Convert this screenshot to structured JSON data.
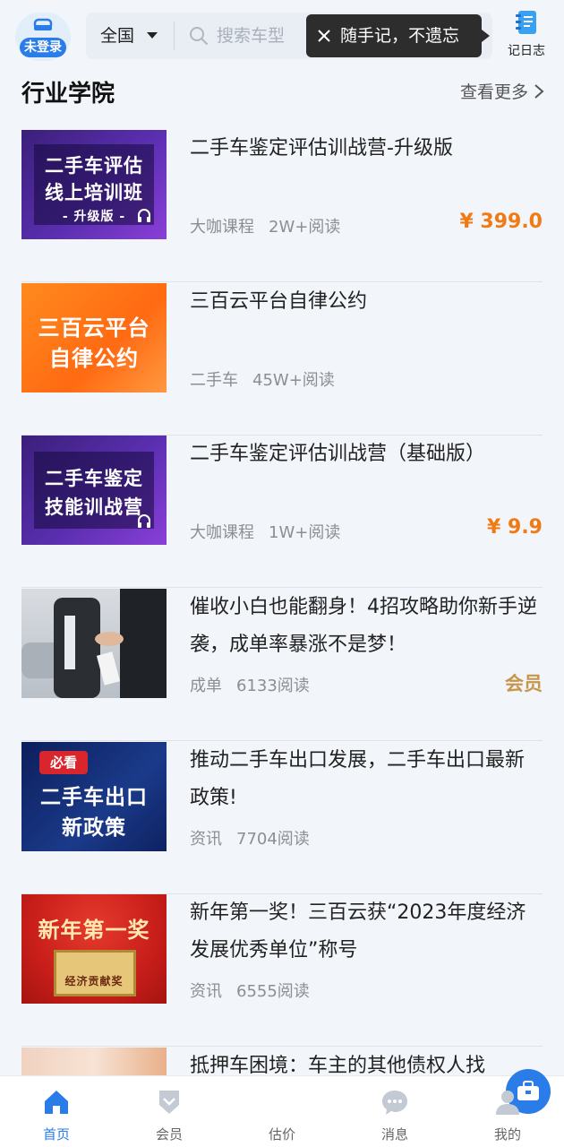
{
  "header": {
    "login_label": "未登录",
    "city": "全国",
    "search_placeholder": "搜索车型",
    "tooltip": "随手记，不遗忘",
    "diary_label": "记日志"
  },
  "section": {
    "title": "行业学院",
    "more_label": "查看更多"
  },
  "articles": [
    {
      "title": "二手车鉴定评估训战营-升级版",
      "category": "大咖课程",
      "reads": "2W+阅读",
      "price": "¥ 399.0",
      "thumb_lines": [
        "二手车评估",
        "线上培训班",
        "- 升级版 -"
      ]
    },
    {
      "title": "三百云平台自律公约",
      "category": "二手车",
      "reads": "45W+阅读",
      "thumb_lines": [
        "三百云平台",
        "自律公约"
      ]
    },
    {
      "title": "二手车鉴定评估训战营（基础版）",
      "category": "大咖课程",
      "reads": "1W+阅读",
      "price": "¥ 9.9",
      "thumb_lines": [
        "二手车鉴定",
        "技能训战营"
      ]
    },
    {
      "title": "催收小白也能翻身！4招攻略助你新手逆袭，成单率暴涨不是梦！",
      "category": "成单",
      "reads": "6133阅读",
      "badge": "会员"
    },
    {
      "title": "推动二手车出口发展，二手车出口最新政策!",
      "category": "资讯",
      "reads": "7704阅读",
      "thumb_tag": "必看",
      "thumb_lines": [
        "二手车出口",
        "新政策"
      ]
    },
    {
      "title": "新年第一奖！三百云获“2023年度经济发展优秀单位”称号",
      "category": "资讯",
      "reads": "6555阅读",
      "thumb_lines": [
        "新年第一奖",
        "经济贡献奖"
      ]
    },
    {
      "title": "抵押车困境：车主的其他债权人找"
    }
  ],
  "bottom_nav": [
    {
      "label": "首页",
      "active": true
    },
    {
      "label": "会员"
    },
    {
      "label": "估价"
    },
    {
      "label": "消息"
    },
    {
      "label": "我的"
    }
  ],
  "colors": {
    "accent": "#2a7ce8",
    "price": "#f07a13",
    "member": "#c8964b",
    "background": "#f2f6fa"
  }
}
